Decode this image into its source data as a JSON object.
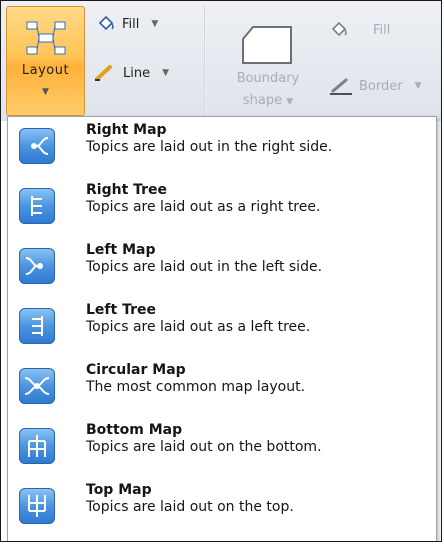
{
  "ribbon": {
    "layout_label": "Layout",
    "fill_label": "Fill",
    "line_label": "Line",
    "boundary_label_line1": "Boundary",
    "boundary_label_line2": "shape",
    "fill2_label": "Fill",
    "border_label": "Border"
  },
  "menu": {
    "items": [
      {
        "title": "Right Map",
        "desc": "Topics are laid out in the right side."
      },
      {
        "title": "Right Tree",
        "desc": "Topics are laid out as a right tree."
      },
      {
        "title": "Left Map",
        "desc": "Topics are laid out in the left side."
      },
      {
        "title": "Left Tree",
        "desc": "Topics are laid out as a left tree."
      },
      {
        "title": "Circular Map",
        "desc": "The most common map layout."
      },
      {
        "title": "Bottom Map",
        "desc": "Topics are laid out on the bottom."
      },
      {
        "title": "Top Map",
        "desc": "Topics are laid out on the top."
      }
    ]
  },
  "colors": {
    "accent_orange": "#ffc457",
    "icon_blue": "#4b95e0",
    "disabled_text": "#a9adb5"
  }
}
